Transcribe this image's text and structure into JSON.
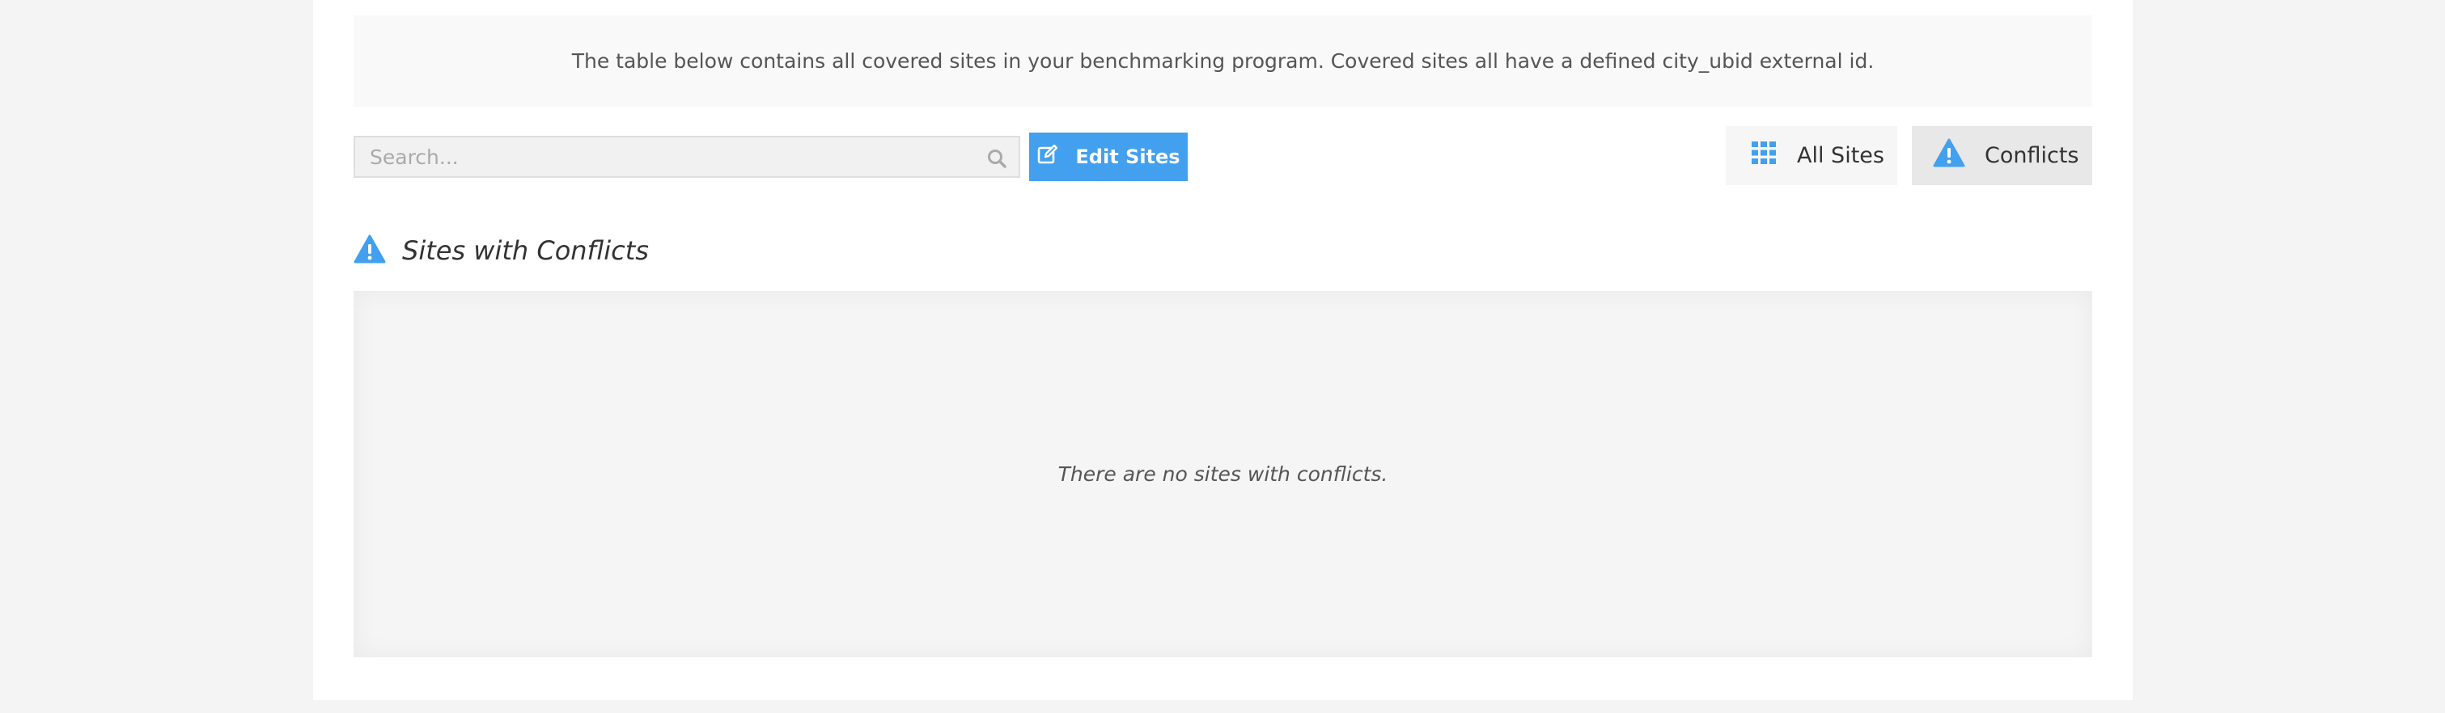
{
  "info": {
    "text": "The table below contains all covered sites in your benchmarking program. Covered sites all have a defined city_ubid external id."
  },
  "search": {
    "placeholder": "Search...",
    "value": ""
  },
  "toolbar": {
    "edit_label": "Edit Sites"
  },
  "view_toggle": {
    "all_label": "All Sites",
    "conflicts_label": "Conflicts",
    "active": "Conflicts"
  },
  "section": {
    "title": "Sites with Conflicts",
    "empty_message": "There are no sites with conflicts."
  },
  "colors": {
    "accent": "#42a0ee",
    "background": "#f4f4f4"
  },
  "icons": {
    "search": "search-icon",
    "edit": "edit-icon",
    "grid": "grid-icon",
    "warning": "warning-icon"
  }
}
